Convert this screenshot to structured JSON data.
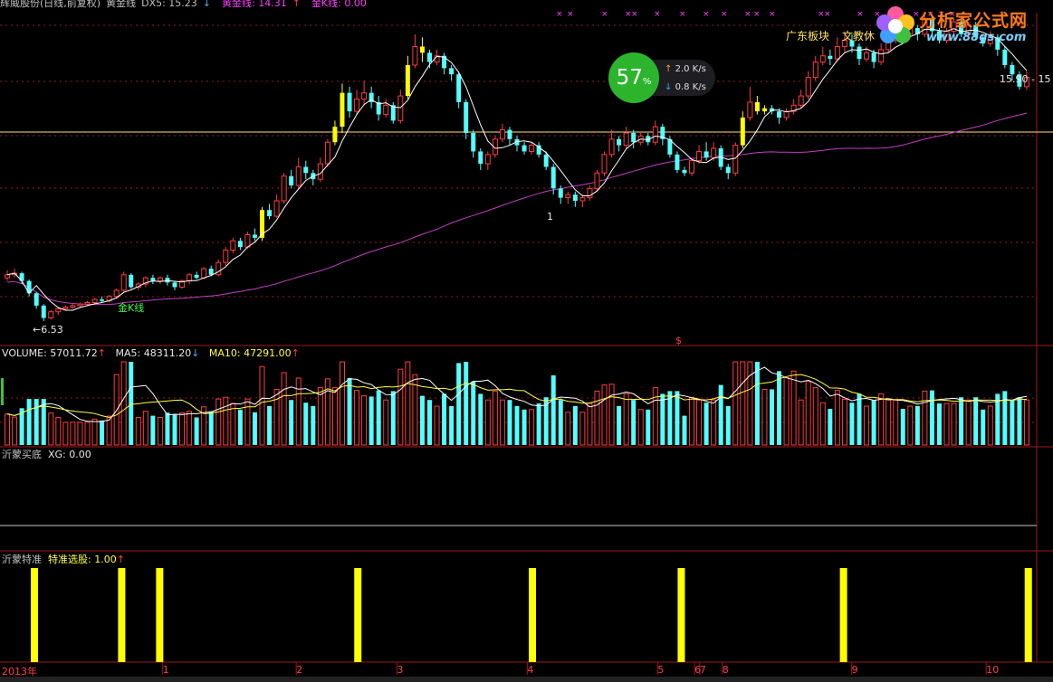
{
  "header": {
    "stock_label": "辉威股份(日线,前复权)",
    "indicator_name": "黄金线",
    "dx5_label": "DX5: 15.23",
    "dx5_arrow": "↓",
    "gold_line_label": "黄金线: 14.31",
    "gold_line_arrow": "↑",
    "gold_k_label": "金K线: 0.00"
  },
  "toolbar": {
    "tab1": "广东板块",
    "tab2": "文教休"
  },
  "logo": {
    "title": "分析家公式网",
    "url": "www.88gs.com"
  },
  "widget": {
    "percent": "57",
    "percent_unit": "%",
    "up_rate": "2.0",
    "down_rate": "0.8",
    "rate_unit": "K/s"
  },
  "price_panel": {
    "low_label": "←6.53",
    "high_label": "15.90 - 15",
    "gold_k_marker": "金K线",
    "dollar_marker": "$",
    "sample_marker": "1"
  },
  "volume_panel": {
    "volume_label": "VOLUME: 57011.72",
    "volume_arrow": "↑",
    "ma5_label": "MA5: 48311.20",
    "ma5_arrow": "↓",
    "ma10_label": "MA10: 47291.00",
    "ma10_arrow": "↑"
  },
  "xg_panel": {
    "name": "沂蒙买底",
    "value_label": "XG: 0.00"
  },
  "signal_panel": {
    "name": "沂蒙特准",
    "value_label": "特准选股: 1.00",
    "arrow": "↑",
    "signal_positions": [
      0.03,
      0.115,
      0.152,
      0.345,
      0.515,
      0.66,
      0.818,
      0.998
    ]
  },
  "time_axis": {
    "year_label": "2013年",
    "months": [
      {
        "label": "1",
        "frac": 0.155
      },
      {
        "label": "2",
        "frac": 0.285
      },
      {
        "label": "3",
        "frac": 0.383
      },
      {
        "label": "4",
        "frac": 0.51
      },
      {
        "label": "5",
        "frac": 0.637
      },
      {
        "label": "6",
        "frac": 0.673
      },
      {
        "label": "7",
        "frac": 0.678
      },
      {
        "label": "8",
        "frac": 0.7
      },
      {
        "label": "9",
        "frac": 0.826
      },
      {
        "label": "10",
        "frac": 0.957
      }
    ]
  },
  "colors": {
    "up": "#ff3c3c",
    "down": "#54ffff",
    "gold": "#ffff00",
    "ma_white": "#ffffff",
    "ma_mag": "#c040c0",
    "grid": "#a01818",
    "hline": "#ffe080"
  },
  "chart_data": {
    "type": "candlestick",
    "price_ylim": [
      6,
      16.5
    ],
    "candles": [
      [
        7.9,
        8.0,
        8.15,
        7.8
      ],
      [
        8.0,
        8.05,
        8.2,
        7.9
      ],
      [
        8.05,
        7.8,
        8.1,
        7.7
      ],
      [
        7.8,
        7.4,
        7.85,
        7.3
      ],
      [
        7.4,
        7.0,
        7.45,
        6.9
      ],
      [
        7.0,
        6.6,
        7.05,
        6.5
      ],
      [
        6.6,
        6.8,
        6.85,
        6.55
      ],
      [
        6.8,
        6.9,
        6.95,
        6.7
      ],
      [
        6.9,
        6.95,
        7.0,
        6.85
      ],
      [
        6.95,
        7.0,
        7.05,
        6.9
      ],
      [
        7.0,
        7.05,
        7.1,
        6.95
      ],
      [
        7.05,
        7.1,
        7.15,
        7.0
      ],
      [
        7.1,
        7.2,
        7.25,
        7.05
      ],
      [
        7.2,
        7.15,
        7.3,
        7.1
      ],
      [
        7.15,
        7.3,
        7.35,
        7.1
      ],
      [
        7.3,
        7.5,
        7.55,
        7.25
      ],
      [
        7.5,
        8.0,
        8.1,
        7.45
      ],
      [
        8.0,
        7.6,
        8.05,
        7.55
      ],
      [
        7.6,
        7.7,
        7.75,
        7.5
      ],
      [
        7.7,
        7.9,
        7.95,
        7.6
      ],
      [
        7.9,
        7.8,
        8.0,
        7.7
      ],
      [
        7.8,
        7.9,
        7.95,
        7.7
      ],
      [
        7.9,
        7.75,
        8.0,
        7.65
      ],
      [
        7.75,
        7.6,
        7.8,
        7.5
      ],
      [
        7.6,
        7.8,
        7.85,
        7.55
      ],
      [
        7.8,
        8.0,
        8.05,
        7.7
      ],
      [
        8.0,
        7.9,
        8.1,
        7.85
      ],
      [
        7.9,
        8.2,
        8.25,
        7.85
      ],
      [
        8.2,
        8.0,
        8.3,
        7.95
      ],
      [
        8.0,
        8.4,
        8.5,
        7.95
      ],
      [
        8.4,
        8.8,
        8.9,
        8.3
      ],
      [
        8.8,
        9.1,
        9.2,
        8.7
      ],
      [
        9.1,
        8.9,
        9.2,
        8.8
      ],
      [
        8.9,
        9.3,
        9.4,
        8.85
      ],
      [
        9.3,
        9.2,
        9.5,
        9.1
      ],
      [
        9.2,
        10.1,
        10.2,
        9.1
      ],
      [
        10.1,
        9.9,
        10.3,
        9.8
      ],
      [
        9.9,
        10.4,
        10.6,
        9.85
      ],
      [
        10.4,
        11.2,
        11.3,
        10.3
      ],
      [
        11.2,
        10.9,
        11.4,
        10.8
      ],
      [
        10.9,
        11.5,
        11.8,
        10.8
      ],
      [
        11.5,
        11.3,
        11.7,
        11.1
      ],
      [
        11.3,
        11.1,
        11.4,
        10.9
      ],
      [
        11.1,
        11.6,
        11.8,
        11.0
      ],
      [
        11.6,
        12.3,
        12.4,
        11.5
      ],
      [
        12.3,
        12.8,
        13.0,
        12.2
      ],
      [
        12.8,
        13.9,
        14.2,
        12.6
      ],
      [
        13.9,
        13.3,
        14.1,
        13.1
      ],
      [
        13.3,
        13.7,
        14.0,
        13.2
      ],
      [
        13.7,
        13.9,
        14.3,
        13.5
      ],
      [
        13.9,
        13.6,
        14.1,
        13.4
      ],
      [
        13.6,
        13.2,
        13.8,
        13.0
      ],
      [
        13.2,
        13.5,
        13.7,
        13.1
      ],
      [
        13.5,
        13.0,
        13.6,
        12.9
      ],
      [
        13.0,
        13.8,
        14.0,
        12.9
      ],
      [
        13.8,
        14.8,
        15.1,
        13.7
      ],
      [
        14.8,
        15.4,
        15.8,
        14.7
      ],
      [
        15.4,
        15.2,
        15.7,
        14.9
      ],
      [
        15.2,
        14.9,
        15.3,
        14.7
      ],
      [
        14.9,
        15.1,
        15.3,
        14.8
      ],
      [
        15.1,
        14.7,
        15.2,
        14.5
      ],
      [
        14.7,
        14.5,
        14.8,
        14.3
      ],
      [
        14.5,
        13.6,
        14.6,
        13.4
      ],
      [
        13.6,
        12.6,
        13.7,
        12.4
      ],
      [
        12.6,
        12.0,
        12.7,
        11.8
      ],
      [
        12.0,
        11.6,
        12.1,
        11.4
      ],
      [
        11.6,
        11.9,
        12.0,
        11.4
      ],
      [
        11.9,
        12.4,
        12.5,
        11.8
      ],
      [
        12.4,
        12.7,
        12.9,
        12.3
      ],
      [
        12.7,
        12.4,
        12.8,
        12.2
      ],
      [
        12.4,
        12.2,
        12.5,
        12.0
      ],
      [
        12.2,
        12.0,
        12.3,
        11.9
      ],
      [
        12.0,
        12.2,
        12.3,
        11.9
      ],
      [
        12.2,
        11.9,
        12.3,
        11.8
      ],
      [
        11.9,
        11.5,
        12.0,
        11.4
      ],
      [
        11.5,
        10.8,
        11.6,
        10.6
      ],
      [
        10.8,
        10.5,
        10.9,
        10.3
      ],
      [
        10.5,
        10.6,
        10.7,
        10.3
      ],
      [
        10.6,
        10.4,
        10.7,
        10.2
      ],
      [
        10.4,
        10.5,
        10.6,
        10.2
      ],
      [
        10.5,
        10.8,
        10.9,
        10.4
      ],
      [
        10.8,
        11.3,
        11.4,
        10.7
      ],
      [
        11.3,
        11.9,
        12.0,
        11.2
      ],
      [
        11.9,
        12.4,
        12.7,
        11.8
      ],
      [
        12.4,
        12.2,
        12.5,
        12.0
      ],
      [
        12.2,
        12.6,
        12.8,
        12.1
      ],
      [
        12.6,
        12.3,
        12.7,
        12.1
      ],
      [
        12.3,
        12.5,
        12.6,
        12.2
      ],
      [
        12.5,
        12.3,
        12.6,
        12.2
      ],
      [
        12.3,
        12.8,
        13.0,
        12.2
      ],
      [
        12.8,
        12.4,
        12.9,
        12.2
      ],
      [
        12.4,
        11.9,
        12.5,
        11.8
      ],
      [
        11.9,
        11.4,
        12.0,
        11.3
      ],
      [
        11.4,
        11.3,
        11.5,
        11.2
      ],
      [
        11.3,
        11.7,
        11.8,
        11.2
      ],
      [
        11.7,
        12.0,
        12.2,
        11.6
      ],
      [
        12.0,
        11.8,
        12.3,
        11.7
      ],
      [
        11.8,
        12.1,
        12.3,
        11.7
      ],
      [
        12.1,
        11.5,
        12.2,
        11.4
      ],
      [
        11.5,
        11.3,
        11.6,
        11.1
      ],
      [
        11.3,
        12.2,
        12.3,
        11.2
      ],
      [
        12.2,
        13.1,
        13.3,
        12.1
      ],
      [
        13.1,
        13.6,
        14.1,
        13.0
      ],
      [
        13.6,
        13.3,
        13.8,
        13.2
      ],
      [
        13.3,
        13.4,
        13.5,
        13.2
      ],
      [
        13.4,
        13.3,
        13.5,
        13.2
      ],
      [
        13.3,
        13.1,
        13.4,
        12.9
      ],
      [
        13.1,
        13.3,
        13.4,
        13.0
      ],
      [
        13.3,
        13.5,
        13.7,
        13.2
      ],
      [
        13.5,
        13.8,
        14.0,
        13.4
      ],
      [
        13.8,
        14.4,
        14.6,
        13.7
      ],
      [
        14.4,
        14.9,
        15.1,
        14.3
      ],
      [
        14.9,
        15.1,
        15.4,
        14.8
      ],
      [
        15.1,
        15.0,
        15.3,
        14.8
      ],
      [
        15.0,
        15.4,
        15.7,
        14.9
      ],
      [
        15.4,
        15.6,
        15.9,
        15.2
      ],
      [
        15.6,
        15.4,
        15.8,
        15.2
      ],
      [
        15.4,
        15.0,
        15.5,
        14.8
      ],
      [
        15.0,
        15.2,
        15.4,
        14.9
      ],
      [
        15.2,
        14.9,
        15.3,
        14.7
      ],
      [
        14.9,
        15.3,
        15.5,
        14.8
      ],
      [
        15.3,
        15.6,
        15.8,
        15.2
      ],
      [
        15.6,
        15.9,
        16.1,
        15.5
      ],
      [
        15.9,
        15.8,
        16.1,
        15.6
      ],
      [
        15.8,
        16.0,
        16.2,
        15.7
      ],
      [
        16.0,
        15.8,
        16.1,
        15.6
      ],
      [
        15.8,
        16.3,
        16.4,
        15.7
      ],
      [
        16.3,
        15.9,
        16.4,
        15.6
      ],
      [
        15.9,
        15.6,
        16.0,
        15.5
      ],
      [
        15.6,
        15.9,
        16.0,
        15.5
      ],
      [
        15.9,
        16.2,
        16.3,
        15.8
      ],
      [
        16.2,
        15.8,
        16.3,
        15.7
      ],
      [
        15.8,
        16.1,
        16.2,
        15.6
      ],
      [
        16.1,
        15.7,
        16.2,
        15.6
      ],
      [
        15.7,
        15.5,
        15.8,
        15.4
      ],
      [
        15.5,
        15.7,
        15.9,
        15.4
      ],
      [
        15.7,
        15.3,
        15.8,
        15.1
      ],
      [
        15.3,
        14.8,
        15.4,
        14.7
      ],
      [
        14.8,
        14.5,
        14.9,
        14.3
      ],
      [
        14.5,
        14.1,
        14.6,
        14.0
      ],
      [
        14.1,
        14.4,
        14.6,
        14.0
      ]
    ],
    "gold_bar_indices": [
      35,
      45,
      46,
      55,
      57,
      101,
      103,
      104
    ]
  }
}
